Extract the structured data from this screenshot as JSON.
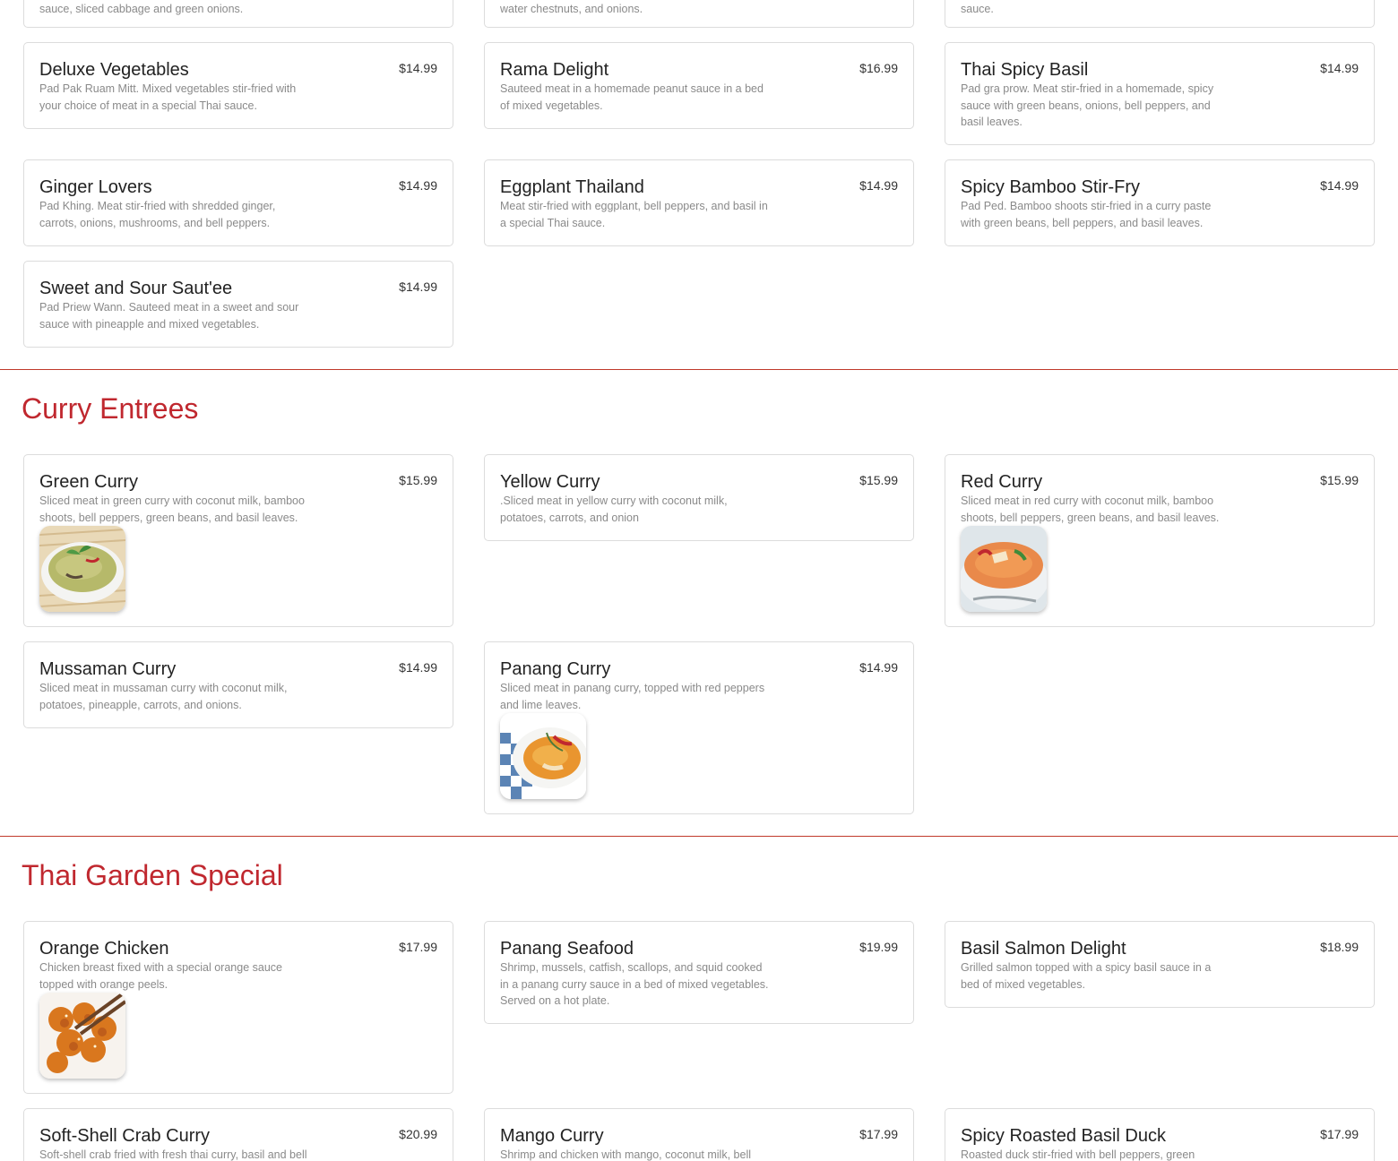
{
  "partial_top": {
    "col1_desc": "sauce, sliced cabbage and green onions.",
    "col2_desc": "water chestnuts, and onions.",
    "col3_desc": "sauce."
  },
  "stirfry": {
    "items": [
      {
        "name": "Deluxe Vegetables",
        "price": "$14.99",
        "desc": "Pad Pak Ruam Mitt. Mixed vegetables stir-fried with your choice of meat in a special Thai sauce."
      },
      {
        "name": "Rama Delight",
        "price": "$16.99",
        "desc": "Sauteed meat in a homemade peanut sauce in a bed of mixed vegetables."
      },
      {
        "name": "Thai Spicy Basil",
        "price": "$14.99",
        "desc": "Pad gra prow. Meat stir-fried in a homemade, spicy sauce with green beans, onions, bell peppers, and basil leaves."
      },
      {
        "name": "Ginger Lovers",
        "price": "$14.99",
        "desc": "Pad Khing. Meat stir-fried with shredded ginger, carrots, onions, mushrooms, and bell peppers."
      },
      {
        "name": "Eggplant Thailand",
        "price": "$14.99",
        "desc": "Meat stir-fried with eggplant, bell peppers, and basil in a special Thai sauce."
      },
      {
        "name": "Spicy Bamboo Stir-Fry",
        "price": "$14.99",
        "desc": "Pad Ped. Bamboo shoots stir-fried in a curry paste with green beans, bell peppers, and basil leaves."
      },
      {
        "name": "Sweet and Sour Saut'ee",
        "price": "$14.99",
        "desc": "Pad Priew Wann. Sauteed meat in a sweet and sour sauce with pineapple and mixed vegetables."
      }
    ]
  },
  "curry": {
    "title": "Curry Entrees",
    "items": [
      {
        "name": "Green Curry",
        "price": "$15.99",
        "desc": "Sliced meat in green curry with coconut milk, bamboo shoots, bell peppers, green beans, and basil leaves.",
        "image": "green-curry-photo"
      },
      {
        "name": "Yellow Curry",
        "price": "$15.99",
        "desc": ".Sliced meat in yellow curry with coconut milk, potatoes, carrots, and onion"
      },
      {
        "name": "Red Curry",
        "price": "$15.99",
        "desc": "Sliced meat in red curry with coconut milk, bamboo shoots, bell peppers, green beans, and basil leaves.",
        "image": "red-curry-photo"
      },
      {
        "name": "Mussaman Curry",
        "price": "$14.99",
        "desc": "Sliced meat in mussaman curry with coconut milk, potatoes, pineapple, carrots, and onions."
      },
      {
        "name": "Panang Curry",
        "price": "$14.99",
        "desc": "Sliced meat in panang curry, topped with red peppers and lime leaves.",
        "image": "panang-curry-photo"
      }
    ]
  },
  "special": {
    "title": "Thai Garden Special",
    "items": [
      {
        "name": "Orange Chicken",
        "price": "$17.99",
        "desc": "Chicken breast fixed with a special orange sauce topped with orange peels.",
        "image": "orange-chicken-photo"
      },
      {
        "name": "Panang Seafood",
        "price": "$19.99",
        "desc": "Shrimp, mussels, catfish, scallops, and squid cooked in a panang curry sauce in a bed of mixed vegetables. Served on a hot plate."
      },
      {
        "name": "Basil Salmon Delight",
        "price": "$18.99",
        "desc": "Grilled salmon topped with a spicy basil sauce in a bed of mixed vegetables."
      },
      {
        "name": "Soft-Shell Crab Curry",
        "price": "$20.99",
        "desc": "Soft-shell crab fried with fresh thai curry, basil and bell"
      },
      {
        "name": "Mango Curry",
        "price": "$17.99",
        "desc": "Shrimp and chicken with mango, coconut milk, bell"
      },
      {
        "name": "Spicy Roasted Basil Duck",
        "price": "$17.99",
        "desc": "Roasted duck stir-fried with bell peppers, green beans,"
      }
    ]
  },
  "colors": {
    "accent": "#c0282f",
    "divider": "#c0392b",
    "card_border": "#dcdcdc",
    "desc_text": "#8a8a8a"
  }
}
